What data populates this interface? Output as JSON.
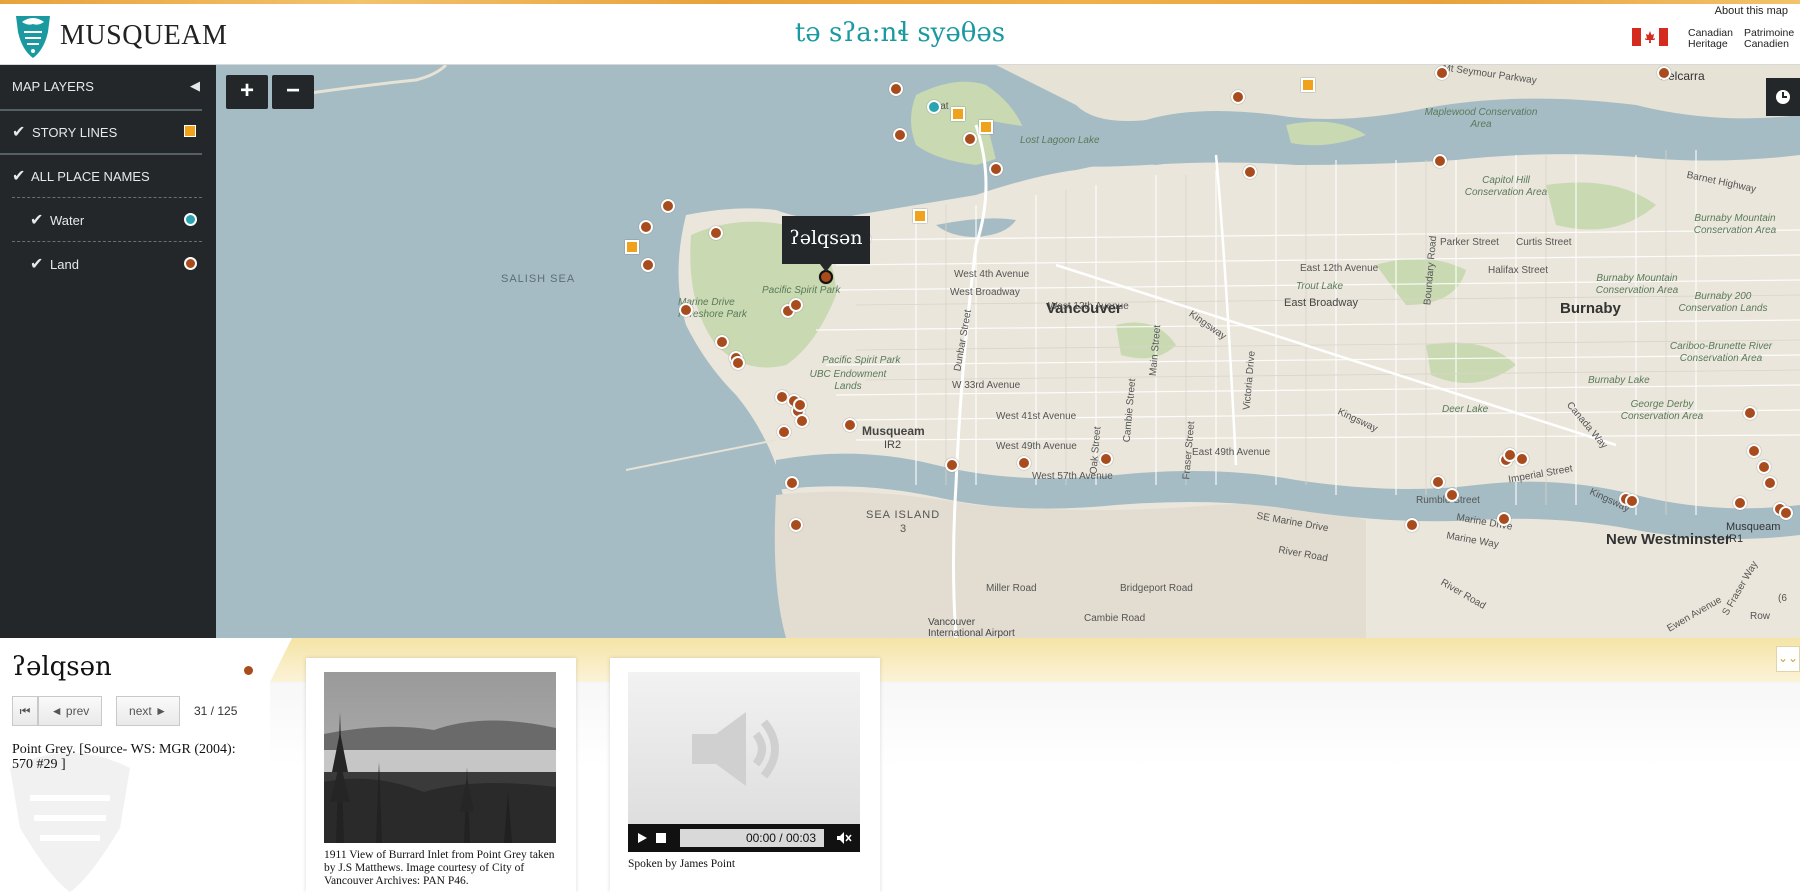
{
  "header": {
    "logo_text": "MUSQUEAM",
    "title": "tə sʔa:nɬ syəθəs",
    "about_link": "About this map",
    "heritage_en_1": "Canadian",
    "heritage_en_2": "Heritage",
    "heritage_fr_1": "Patrimoine",
    "heritage_fr_2": "Canadien"
  },
  "sidebar": {
    "map_layers": "MAP LAYERS",
    "story_lines": "STORY LINES",
    "all_place_names": "ALL PLACE NAMES",
    "water": "Water",
    "land": "Land",
    "check": "✔",
    "collapse_arrow": "◀"
  },
  "map": {
    "zoom_in": "+",
    "zoom_out": "−",
    "popup": "ʔəlqsən",
    "labels": {
      "salish_sea": "SALISH SEA",
      "vancouver": "Vancouver",
      "burnaby": "Burnaby",
      "new_westminster": "New Westminster",
      "belcarra": "Belcarra",
      "musqueam_ir": "Musqueam",
      "ir2": "IR2",
      "sea_island": "SEA ISLAND",
      "sea_island_3": "3",
      "pacific_spirit_park": "Pacific Spirit Park",
      "pacific_spirit_park_2": "Pacific Spirit Park",
      "ubc_endowment_lands": "UBC Endowment Lands",
      "marine_drive_foreshore": "Marine Drive Foreshore Park",
      "burnaby_mountain": "Burnaby Mountain Conservation Area",
      "burnaby_lake": "Burnaby Lake",
      "burnaby_200": "Burnaby 200 Conservation Lands",
      "maplewood": "Maplewood Conservation Area",
      "capitol_hill": "Capitol Hill Conservation Area",
      "caribou_brunette": "Cariboo-Brunette River Conservation Area",
      "george_derby": "George Derby Conservation Area",
      "deer_lake": "Deer Lake",
      "trout_lake": "Trout Lake",
      "lost_lagoon": "Lost Lagoon Lake",
      "vancouver_intl": "Vancouver International Airport",
      "musqueam_ir1": "Musqueam IR1",
      "w4th": "West 4th Avenue",
      "broadway": "West Broadway",
      "w12th": "West 12th Avenue",
      "w33rd": "W 33rd Avenue",
      "w41st": "West 41st Avenue",
      "w49th": "West 49th Avenue",
      "w57th": "West 57th Avenue",
      "e12th": "East 12th Avenue",
      "e_broadway": "East Broadway",
      "e49th": "East 49th Avenue",
      "kingsway": "Kingsway",
      "kingsway2": "Kingsway",
      "kingsway3": "Kingsway",
      "parker": "Parker Street",
      "curtis": "Curtis Street",
      "halifax": "Halifax Street",
      "barnet": "Barnet Highway",
      "mt_seymour": "Mt Seymour Parkway",
      "rumble": "Rumble Street",
      "imperial": "Imperial Street",
      "marine_way": "Marine Way",
      "marine_drive": "Marine Drive",
      "se_marine": "SE Marine Drive",
      "river_road": "River Road",
      "river_road2": "River Road",
      "bridgeport": "Bridgeport Road",
      "miller": "Miller Road",
      "cambie_rd": "Cambie Road",
      "dunbar": "Dunbar Street",
      "oak": "Oak Street",
      "cambie": "Cambie Street",
      "main": "Main Street",
      "fraser": "Fraser Street",
      "victoria": "Victoria Drive",
      "boundary": "Boundary Road",
      "canada_way": "Canada Way",
      "boat": "Boat",
      "s_fraser": "S Fraser Way",
      "ewen": "Ewen Avenue",
      "row": "Row",
      "ls": "(6"
    }
  },
  "detail": {
    "place_name": "ʔəlqsən",
    "first_icon": "⏮",
    "prev": "◄  prev",
    "next": "next  ►",
    "counter": "31 / 125",
    "description": "Point Grey. [Source- WS: MGR (2004): 570 #29 ]",
    "photo_caption": "1911 View of Burrard Inlet from Point Grey taken by J.S Matthews. Image courtesy of City of Vancouver Archives: PAN P46.",
    "audio_time": "00:00 / 00:03",
    "audio_caption": "Spoken by James Point",
    "collapse": "⌄⌄"
  },
  "colors": {
    "sidebar_bg": "#23272a",
    "story_orange": "#f0a21c",
    "water_teal": "#2aa4b0",
    "land_brown": "#a84c1d",
    "title_teal": "#1a9aa0",
    "map_water": "#a5bcc4",
    "map_land": "#eae6db"
  },
  "icons": {
    "logo": "musqueam-logo-icon",
    "flag": "canada-flag-icon",
    "clock": "clock-icon",
    "speaker": "speaker-icon",
    "play": "play-icon",
    "stop": "stop-icon",
    "mute": "mute-icon"
  }
}
